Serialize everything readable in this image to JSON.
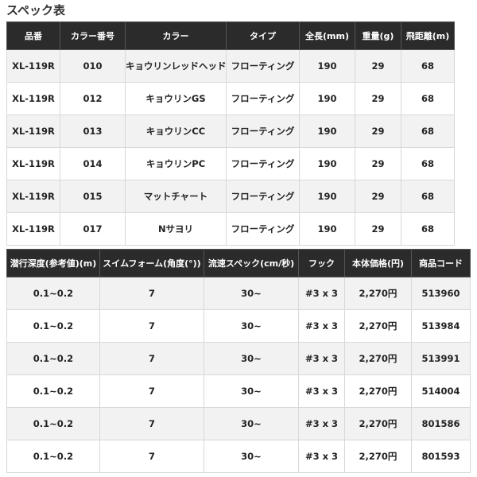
{
  "title": "スペック表",
  "table1": {
    "headers": [
      "品番",
      "カラー番号",
      "カラー",
      "タイプ",
      "全長(mm)",
      "重量(g)",
      "飛距離(m)"
    ],
    "rows": [
      [
        "XL-119R",
        "010",
        "キョウリンレッドヘッド",
        "フローティング",
        "190",
        "29",
        "68"
      ],
      [
        "XL-119R",
        "012",
        "キョウリンGS",
        "フローティング",
        "190",
        "29",
        "68"
      ],
      [
        "XL-119R",
        "013",
        "キョウリンCC",
        "フローティング",
        "190",
        "29",
        "68"
      ],
      [
        "XL-119R",
        "014",
        "キョウリンPC",
        "フローティング",
        "190",
        "29",
        "68"
      ],
      [
        "XL-119R",
        "015",
        "マットチャート",
        "フローティング",
        "190",
        "29",
        "68"
      ],
      [
        "XL-119R",
        "017",
        "Nサヨリ",
        "フローティング",
        "190",
        "29",
        "68"
      ]
    ]
  },
  "table2": {
    "headers": [
      "潜行深度(参考値)(m)",
      "スイムフォーム(角度(°))",
      "流速スペック(cm/秒)",
      "フック",
      "本体価格(円)",
      "商品コード"
    ],
    "rows": [
      [
        "0.1~0.2",
        "7",
        "30~",
        "#3 x 3",
        "2,270円",
        "513960"
      ],
      [
        "0.1~0.2",
        "7",
        "30~",
        "#3 x 3",
        "2,270円",
        "513984"
      ],
      [
        "0.1~0.2",
        "7",
        "30~",
        "#3 x 3",
        "2,270円",
        "513991"
      ],
      [
        "0.1~0.2",
        "7",
        "30~",
        "#3 x 3",
        "2,270円",
        "514004"
      ],
      [
        "0.1~0.2",
        "7",
        "30~",
        "#3 x 3",
        "2,270円",
        "801586"
      ],
      [
        "0.1~0.2",
        "7",
        "30~",
        "#3 x 3",
        "2,270円",
        "801593"
      ]
    ]
  }
}
